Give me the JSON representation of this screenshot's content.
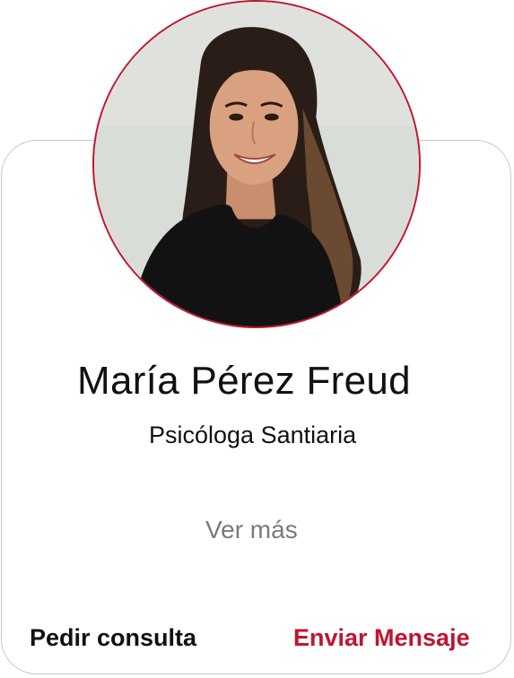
{
  "profile": {
    "name": "María Pérez Freud",
    "role": "Psicóloga Santiaria",
    "more_label": "Ver más",
    "avatar_icon": "person-photo"
  },
  "actions": {
    "consult_label": "Pedir consulta",
    "message_label": "Enviar Mensaje"
  },
  "colors": {
    "accent": "#c0152f",
    "text": "#111111",
    "muted": "#7a7a7a",
    "border": "#c8c8c8"
  }
}
